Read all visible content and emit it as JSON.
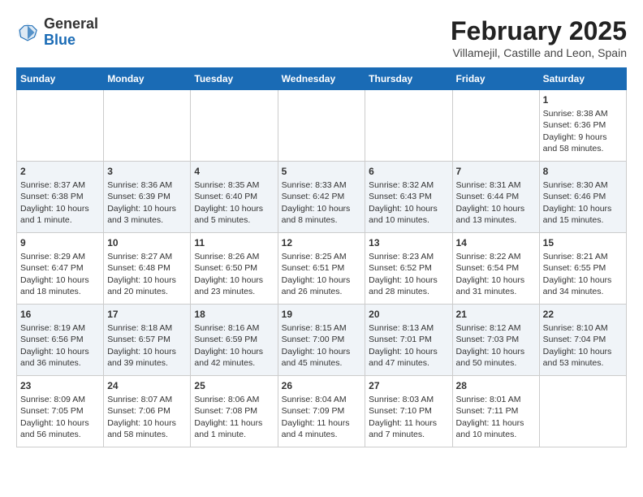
{
  "logo": {
    "general": "General",
    "blue": "Blue"
  },
  "header": {
    "month": "February 2025",
    "location": "Villamejil, Castille and Leon, Spain"
  },
  "weekdays": [
    "Sunday",
    "Monday",
    "Tuesday",
    "Wednesday",
    "Thursday",
    "Friday",
    "Saturday"
  ],
  "weeks": [
    [
      {
        "day": "",
        "info": ""
      },
      {
        "day": "",
        "info": ""
      },
      {
        "day": "",
        "info": ""
      },
      {
        "day": "",
        "info": ""
      },
      {
        "day": "",
        "info": ""
      },
      {
        "day": "",
        "info": ""
      },
      {
        "day": "1",
        "info": "Sunrise: 8:38 AM\nSunset: 6:36 PM\nDaylight: 9 hours and 58 minutes."
      }
    ],
    [
      {
        "day": "2",
        "info": "Sunrise: 8:37 AM\nSunset: 6:38 PM\nDaylight: 10 hours and 1 minute."
      },
      {
        "day": "3",
        "info": "Sunrise: 8:36 AM\nSunset: 6:39 PM\nDaylight: 10 hours and 3 minutes."
      },
      {
        "day": "4",
        "info": "Sunrise: 8:35 AM\nSunset: 6:40 PM\nDaylight: 10 hours and 5 minutes."
      },
      {
        "day": "5",
        "info": "Sunrise: 8:33 AM\nSunset: 6:42 PM\nDaylight: 10 hours and 8 minutes."
      },
      {
        "day": "6",
        "info": "Sunrise: 8:32 AM\nSunset: 6:43 PM\nDaylight: 10 hours and 10 minutes."
      },
      {
        "day": "7",
        "info": "Sunrise: 8:31 AM\nSunset: 6:44 PM\nDaylight: 10 hours and 13 minutes."
      },
      {
        "day": "8",
        "info": "Sunrise: 8:30 AM\nSunset: 6:46 PM\nDaylight: 10 hours and 15 minutes."
      }
    ],
    [
      {
        "day": "9",
        "info": "Sunrise: 8:29 AM\nSunset: 6:47 PM\nDaylight: 10 hours and 18 minutes."
      },
      {
        "day": "10",
        "info": "Sunrise: 8:27 AM\nSunset: 6:48 PM\nDaylight: 10 hours and 20 minutes."
      },
      {
        "day": "11",
        "info": "Sunrise: 8:26 AM\nSunset: 6:50 PM\nDaylight: 10 hours and 23 minutes."
      },
      {
        "day": "12",
        "info": "Sunrise: 8:25 AM\nSunset: 6:51 PM\nDaylight: 10 hours and 26 minutes."
      },
      {
        "day": "13",
        "info": "Sunrise: 8:23 AM\nSunset: 6:52 PM\nDaylight: 10 hours and 28 minutes."
      },
      {
        "day": "14",
        "info": "Sunrise: 8:22 AM\nSunset: 6:54 PM\nDaylight: 10 hours and 31 minutes."
      },
      {
        "day": "15",
        "info": "Sunrise: 8:21 AM\nSunset: 6:55 PM\nDaylight: 10 hours and 34 minutes."
      }
    ],
    [
      {
        "day": "16",
        "info": "Sunrise: 8:19 AM\nSunset: 6:56 PM\nDaylight: 10 hours and 36 minutes."
      },
      {
        "day": "17",
        "info": "Sunrise: 8:18 AM\nSunset: 6:57 PM\nDaylight: 10 hours and 39 minutes."
      },
      {
        "day": "18",
        "info": "Sunrise: 8:16 AM\nSunset: 6:59 PM\nDaylight: 10 hours and 42 minutes."
      },
      {
        "day": "19",
        "info": "Sunrise: 8:15 AM\nSunset: 7:00 PM\nDaylight: 10 hours and 45 minutes."
      },
      {
        "day": "20",
        "info": "Sunrise: 8:13 AM\nSunset: 7:01 PM\nDaylight: 10 hours and 47 minutes."
      },
      {
        "day": "21",
        "info": "Sunrise: 8:12 AM\nSunset: 7:03 PM\nDaylight: 10 hours and 50 minutes."
      },
      {
        "day": "22",
        "info": "Sunrise: 8:10 AM\nSunset: 7:04 PM\nDaylight: 10 hours and 53 minutes."
      }
    ],
    [
      {
        "day": "23",
        "info": "Sunrise: 8:09 AM\nSunset: 7:05 PM\nDaylight: 10 hours and 56 minutes."
      },
      {
        "day": "24",
        "info": "Sunrise: 8:07 AM\nSunset: 7:06 PM\nDaylight: 10 hours and 58 minutes."
      },
      {
        "day": "25",
        "info": "Sunrise: 8:06 AM\nSunset: 7:08 PM\nDaylight: 11 hours and 1 minute."
      },
      {
        "day": "26",
        "info": "Sunrise: 8:04 AM\nSunset: 7:09 PM\nDaylight: 11 hours and 4 minutes."
      },
      {
        "day": "27",
        "info": "Sunrise: 8:03 AM\nSunset: 7:10 PM\nDaylight: 11 hours and 7 minutes."
      },
      {
        "day": "28",
        "info": "Sunrise: 8:01 AM\nSunset: 7:11 PM\nDaylight: 11 hours and 10 minutes."
      },
      {
        "day": "",
        "info": ""
      }
    ]
  ]
}
